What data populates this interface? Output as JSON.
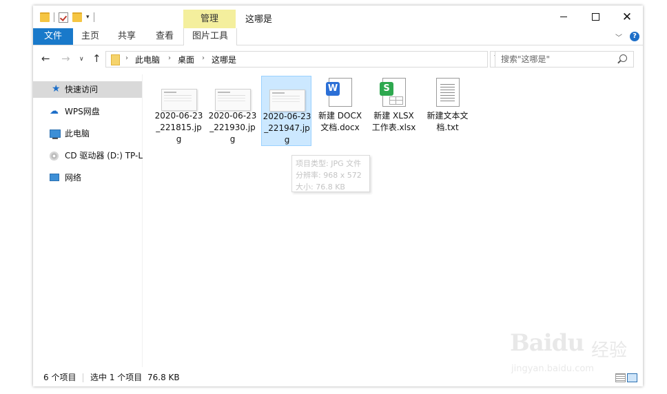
{
  "window": {
    "title": "这哪是",
    "controls": {
      "close_glyph": "✕"
    }
  },
  "ribbon": {
    "contextual_group": "管理",
    "tabs": {
      "file": "文件",
      "home": "主页",
      "share": "共享",
      "view": "查看",
      "picture_tools": "图片工具"
    },
    "help": "?"
  },
  "nav": {
    "breadcrumb": [
      "此电脑",
      "桌面",
      "这哪是"
    ],
    "search_placeholder": "搜索\"这哪是\""
  },
  "sidebar": {
    "items": [
      {
        "label": "快速访问",
        "icon": "star-icon"
      },
      {
        "label": "WPS网盘",
        "icon": "cloud-icon"
      },
      {
        "label": "此电脑",
        "icon": "computer-icon"
      },
      {
        "label": "CD 驱动器 (D:) TP-L",
        "icon": "cd-drive-icon"
      },
      {
        "label": "网络",
        "icon": "network-icon"
      }
    ]
  },
  "files": [
    {
      "name": "2020-06-23_221815.jpg",
      "type": "jpg",
      "selected": false
    },
    {
      "name": "2020-06-23_221930.jpg",
      "type": "jpg",
      "selected": false
    },
    {
      "name": "2020-06-23_221947.jpg",
      "type": "jpg",
      "selected": true
    },
    {
      "name": "新建 DOCX 文档.docx",
      "type": "docx",
      "selected": false
    },
    {
      "name": "新建 XLSX 工作表.xlsx",
      "type": "xlsx",
      "selected": false
    },
    {
      "name": "新建文本文档.txt",
      "type": "txt",
      "selected": false
    }
  ],
  "file_labels": {
    "f0": "2020-06-23_221815.jpg",
    "f1": "2020-06-23_221930.jpg",
    "f2": "2020-06-23_221947.jpg",
    "f3": "新建 DOCX 文档.docx",
    "f4": "新建 XLSX 工作表.xlsx",
    "f5": "新建文本文档.txt"
  },
  "tooltip": {
    "line1": "项目类型: JPG 文件",
    "line2": "分辨率: 968 x 572",
    "line3": "大小: 76.8 KB"
  },
  "status": {
    "count": "6 个项目",
    "selection": "选中 1 个项目",
    "size": "76.8 KB"
  },
  "watermark": {
    "logo_text": "Baidu",
    "cn_text": "经验",
    "url": "jingyan.baidu.com"
  },
  "colors": {
    "accent": "#1979ca",
    "contextual_tab": "#f4ef9d",
    "selection": "#cce8ff"
  }
}
